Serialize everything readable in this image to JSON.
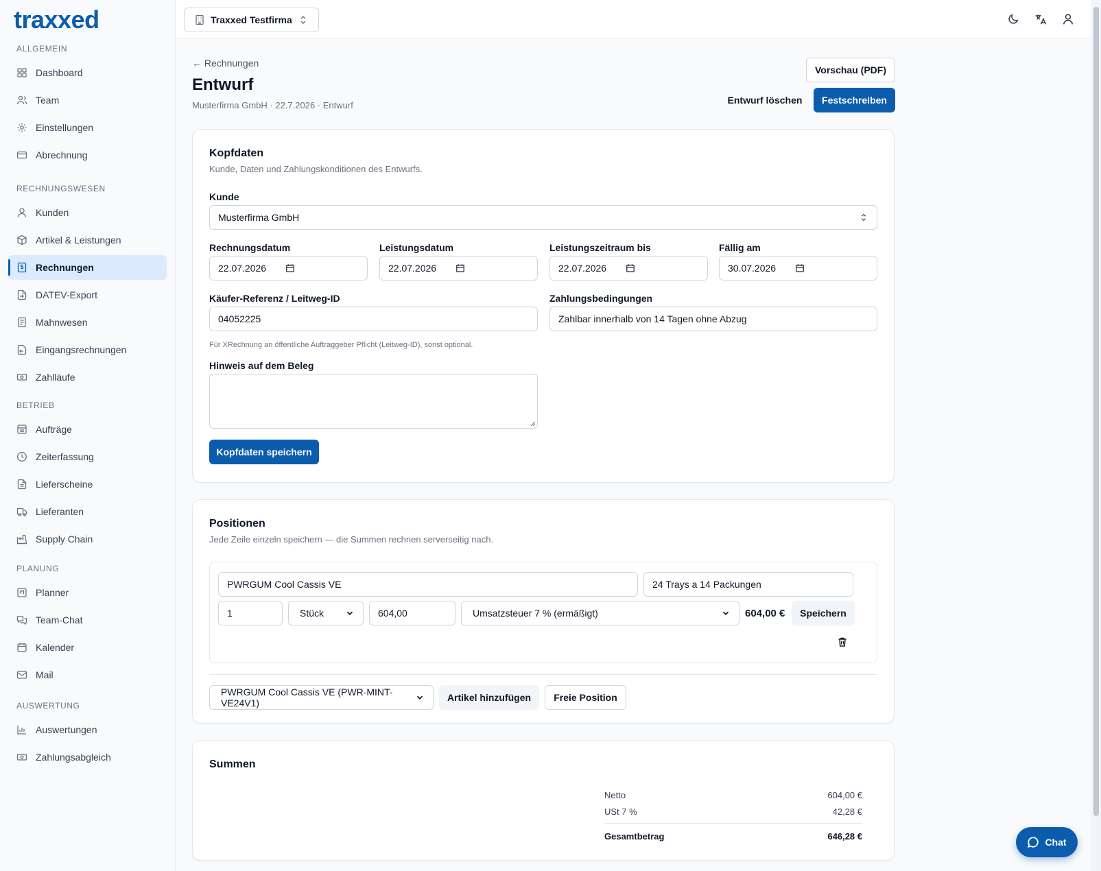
{
  "app": {
    "logo": "traxxed"
  },
  "sidebar": {
    "sections": [
      {
        "title": "ALLGEMEIN"
      },
      {
        "title": "RECHNUNGSWESEN"
      },
      {
        "title": "BETRIEB"
      },
      {
        "title": "PLANUNG"
      },
      {
        "title": "AUSWERTUNG"
      }
    ],
    "items": [
      {
        "label": "Dashboard",
        "icon": "grid-icon"
      },
      {
        "label": "Team",
        "icon": "users-icon"
      },
      {
        "label": "Einstellungen",
        "icon": "gear-icon"
      },
      {
        "label": "Abrechnung",
        "icon": "credit-card-icon"
      },
      {
        "label": "Kunden",
        "icon": "user-icon"
      },
      {
        "label": "Artikel & Leistungen",
        "icon": "package-icon"
      },
      {
        "label": "Rechnungen",
        "icon": "invoice-icon"
      },
      {
        "label": "DATEV-Export",
        "icon": "export-icon"
      },
      {
        "label": "Mahnwesen",
        "icon": "reminder-icon"
      },
      {
        "label": "Eingangsrechnungen",
        "icon": "inbox-icon"
      },
      {
        "label": "Zahlläufe",
        "icon": "banknote-icon"
      },
      {
        "label": "Aufträge",
        "icon": "orders-icon"
      },
      {
        "label": "Zeiterfassung",
        "icon": "clock-icon"
      },
      {
        "label": "Lieferscheine",
        "icon": "document-icon"
      },
      {
        "label": "Lieferanten",
        "icon": "truck-icon"
      },
      {
        "label": "Supply Chain",
        "icon": "factory-icon"
      },
      {
        "label": "Planner",
        "icon": "kanban-icon"
      },
      {
        "label": "Team-Chat",
        "icon": "chat-icon"
      },
      {
        "label": "Kalender",
        "icon": "calendar-icon"
      },
      {
        "label": "Mail",
        "icon": "mail-icon"
      },
      {
        "label": "Auswertungen",
        "icon": "bar-chart-icon"
      },
      {
        "label": "Zahlungsabgleich",
        "icon": "banknote-icon"
      }
    ],
    "active_item": "Rechnungen"
  },
  "topbar": {
    "company": "Traxxed Testfirma",
    "icons": [
      "moon-icon",
      "translate-icon",
      "user-icon"
    ]
  },
  "header": {
    "back_label": "← Rechnungen",
    "title": "Entwurf",
    "subtitle": "Musterfirma GmbH · 22.7.2026 · Entwurf",
    "preview_button": "Vorschau (PDF)",
    "delete_button": "Entwurf löschen",
    "finalize_button": "Festschreiben"
  },
  "kopfdaten": {
    "title": "Kopfdaten",
    "subtitle": "Kunde, Daten und Zahlungskonditionen des Entwurfs.",
    "kunde_label": "Kunde",
    "kunde_value": "Musterfirma GmbH",
    "rechnungsdatum_label": "Rechnungsdatum",
    "rechnungsdatum_value": "22.07.2026",
    "leistungsdatum_label": "Leistungsdatum",
    "leistungsdatum_value": "22.07.2026",
    "leistungszeitraum_label": "Leistungszeitraum bis",
    "leistungszeitraum_value": "22.07.2026",
    "faellig_label": "Fällig am",
    "faellig_value": "30.07.2026",
    "referenz_label": "Käufer-Referenz / Leitweg-ID",
    "referenz_value": "04052225",
    "referenz_hint": "Für XRechnung an öffentliche Auftraggeber Pflicht (Leitweg-ID), sonst optional.",
    "zahlungsbedingungen_label": "Zahlungsbedingungen",
    "zahlungsbedingungen_value": "Zahlbar innerhalb von 14 Tagen ohne Abzug",
    "hinweis_label": "Hinweis auf dem Beleg",
    "hinweis_value": "",
    "save_button": "Kopfdaten speichern"
  },
  "positionen": {
    "title": "Positionen",
    "subtitle": "Jede Zeile einzeln speichern — die Summen rechnen serverseitig nach.",
    "line": {
      "name": "PWRGUM Cool Cassis VE",
      "description": "24 Trays a 14 Packungen",
      "quantity": "1",
      "unit": "Stück",
      "price": "604,00",
      "tax": "Umsatzsteuer 7 % (ermäßigt)",
      "total": "604,00 €",
      "save_button": "Speichern"
    },
    "article_select": "PWRGUM Cool Cassis VE (PWR-MINT-VE24V1)",
    "add_article_button": "Artikel hinzufügen",
    "free_position_button": "Freie Position"
  },
  "summen": {
    "title": "Summen",
    "netto_label": "Netto",
    "netto_value": "604,00 €",
    "ust_label": "USt 7 %",
    "ust_value": "42,28 €",
    "gesamt_label": "Gesamtbetrag",
    "gesamt_value": "646,28 €"
  },
  "chat": {
    "label": "Chat"
  },
  "colors": {
    "primary": "#0b5cad",
    "active_bg": "#dbeafe"
  }
}
